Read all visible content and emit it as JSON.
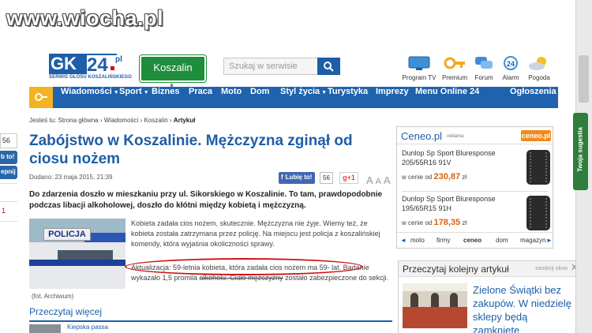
{
  "watermark": "www.wiocha.pl",
  "left_fragments": [
    "56",
    "b to!",
    "epnij",
    "1"
  ],
  "logo": {
    "gk": "GK",
    "n24": "24",
    "pl": "pl",
    "subtitle": "SERWIS GŁOSU KOSZALIŃSKIEGO"
  },
  "city": "Koszalin",
  "search": {
    "placeholder": "Szukaj w serwisie"
  },
  "header_icons": [
    {
      "label": "Program TV",
      "icon": "tv-icon"
    },
    {
      "label": "Premium",
      "icon": "key-icon"
    },
    {
      "label": "Forum",
      "icon": "forum-icon"
    },
    {
      "label": "Alarm",
      "icon": "alarm-24-icon"
    },
    {
      "label": "Pogoda",
      "icon": "weather-icon"
    }
  ],
  "nav": {
    "items": [
      "Wiadomości",
      "Sport",
      "Biznes",
      "Praca",
      "Moto",
      "Dom",
      "Styl życia",
      "Turystyka",
      "Imprezy",
      "Menu Online 24",
      "Ogłoszenia"
    ]
  },
  "breadcrumb": {
    "prefix": "Jesteś tu:",
    "items": [
      "Strona główna",
      "Wiadomości",
      "Koszalin"
    ],
    "current": "Artykuł"
  },
  "article": {
    "title": "Zabójstwo w Koszalinie. Mężczyzna zginął od ciosu nożem",
    "date": "Dodano: 23 maja 2015, 21:39",
    "like_label": "Lubię to!",
    "like_count": "56",
    "gplus_label": "g+1",
    "font_sizes": [
      "A",
      "A",
      "A"
    ],
    "lead": "Do zdarzenia doszło w mieszkaniu przy ul. Sikorskiego w Koszalinie. To tam, prawdopodobnie podczas libacji alkoholowej, doszło do kłótni między kobietą i mężczyzną.",
    "photo_sign": "POLICJA",
    "photo_caption": "(fot. Archiwum)",
    "p1": "Kobieta zadała cios nożem, skutecznie. Mężczyzna nie żyje. Wiemy też, że kobieta została zatrzymana przez policję. Na miejscu jest policja z koszalińskiej komendy, która wyjaśnia okoliczności sprawy.",
    "p2_a": "Aktualizacja: 59-letnia kobieta, która zadała cios nożem ma 59- lat. Badanie wykazało 1,5 promila ",
    "p2_strike": "alkoholu. Ciało mężczyzny",
    "p2_b": " zostało zabezpieczone do sekcji."
  },
  "more": {
    "heading": "Przeczytaj więcej",
    "link": "Kiepska passa"
  },
  "ceneo": {
    "brand": "Ceneo.pl",
    "ad_label": "reklama",
    "logo_text": "ceneo.pl",
    "products": [
      {
        "name": "Dunlop Sp Sport Bluresponse 205/55R16 91V",
        "prefix": "w cenie od",
        "price": "230,87",
        "currency": "zł"
      },
      {
        "name": "Dunlop Sp Sport Bluresponse 195/65R15 91H",
        "prefix": "w cenie od",
        "price": "178,35",
        "currency": "zł"
      }
    ],
    "tabs": [
      "moto",
      "firmy",
      "ceneo",
      "dom",
      "magazyn"
    ],
    "tab_arrows": [
      "◄",
      "►"
    ]
  },
  "next": {
    "heading": "Przeczytaj kolejny artykuł",
    "close_label": "zamknij okno",
    "close_x": "X",
    "title": "Zielone Świątki bez zakupów. W niedzielę sklepy będą zamknięte"
  },
  "feedback": "Twoja sugestia",
  "colors": {
    "brand_blue": "#1e5ea8",
    "nav_blue": "#1f62ad",
    "highlight_red": "#d01010",
    "price_orange": "#e0600a"
  }
}
